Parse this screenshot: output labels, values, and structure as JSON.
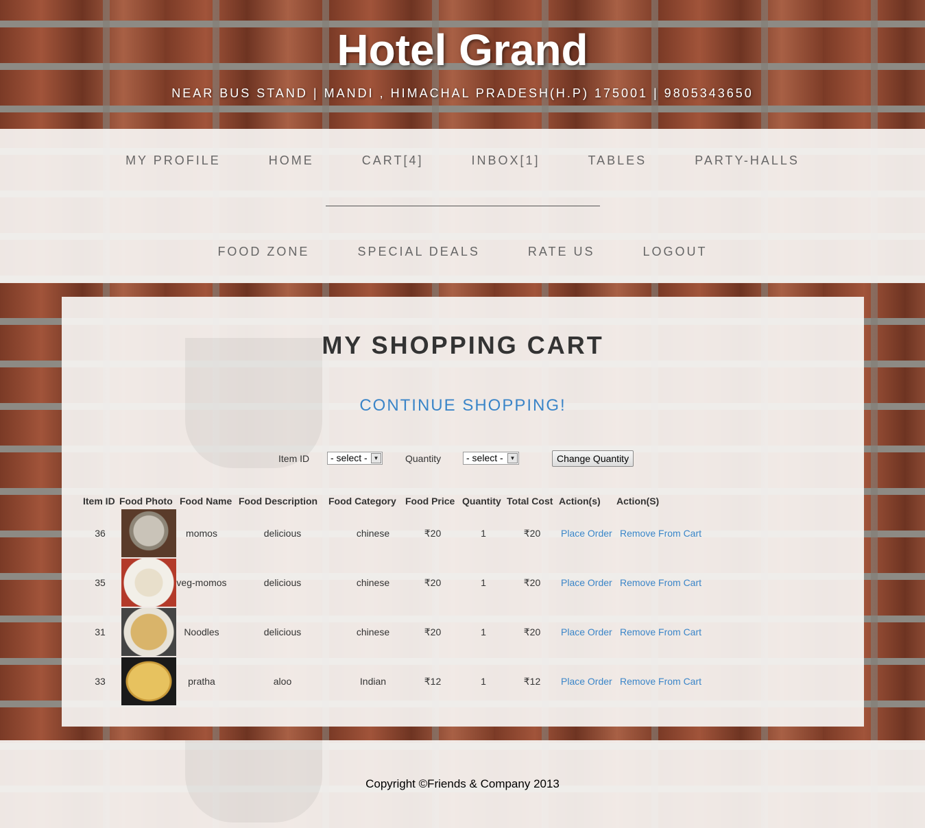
{
  "header": {
    "title": "Hotel Grand",
    "address": "NEAR BUS STAND | MANDI , HIMACHAL PRADESH(H.P) 175001 | 9805343650"
  },
  "nav": {
    "row1": [
      "MY PROFILE",
      "HOME",
      "CART[4]",
      "INBOX[1]",
      "TABLES",
      "PARTY-HALLS"
    ],
    "row2": [
      "FOOD ZONE",
      "SPECIAL DEALS",
      "RATE US",
      "LOGOUT"
    ]
  },
  "cart": {
    "title": "MY SHOPPING CART",
    "continue_label": "CONTINUE SHOPPING!",
    "form": {
      "item_id_label": "Item ID",
      "item_id_value": "- select -",
      "quantity_label": "Quantity",
      "quantity_value": "- select -",
      "change_button": "Change Quantity"
    },
    "columns": [
      "Item ID",
      "Food Photo",
      "Food Name",
      "Food Description",
      "Food Category",
      "Food Price",
      "Quantity",
      "Total Cost",
      "Action(s)",
      "Action(S)"
    ],
    "rows": [
      {
        "id": "36",
        "photo": "momos-photo",
        "name": "momos",
        "description": "delicious",
        "category": "chinese",
        "price": "₹20",
        "quantity": "1",
        "total": "₹20",
        "action1": "Place Order",
        "action2": "Remove From Cart"
      },
      {
        "id": "35",
        "photo": "veg-momos-photo",
        "name": "veg-momos",
        "description": "delicious",
        "category": "chinese",
        "price": "₹20",
        "quantity": "1",
        "total": "₹20",
        "action1": "Place Order",
        "action2": "Remove From Cart"
      },
      {
        "id": "31",
        "photo": "noodles-photo",
        "name": "Noodles",
        "description": "delicious",
        "category": "chinese",
        "price": "₹20",
        "quantity": "1",
        "total": "₹20",
        "action1": "Place Order",
        "action2": "Remove From Cart"
      },
      {
        "id": "33",
        "photo": "pratha-photo",
        "name": "pratha",
        "description": "aloo",
        "category": "Indian",
        "price": "₹12",
        "quantity": "1",
        "total": "₹12",
        "action1": "Place Order",
        "action2": "Remove From Cart"
      }
    ]
  },
  "footer": {
    "copyright": "Copyright ©Friends & Company 2013"
  },
  "colors": {
    "link": "#3a85c8",
    "nav_text": "#666666",
    "panel_bg": "#f6f4f2"
  }
}
